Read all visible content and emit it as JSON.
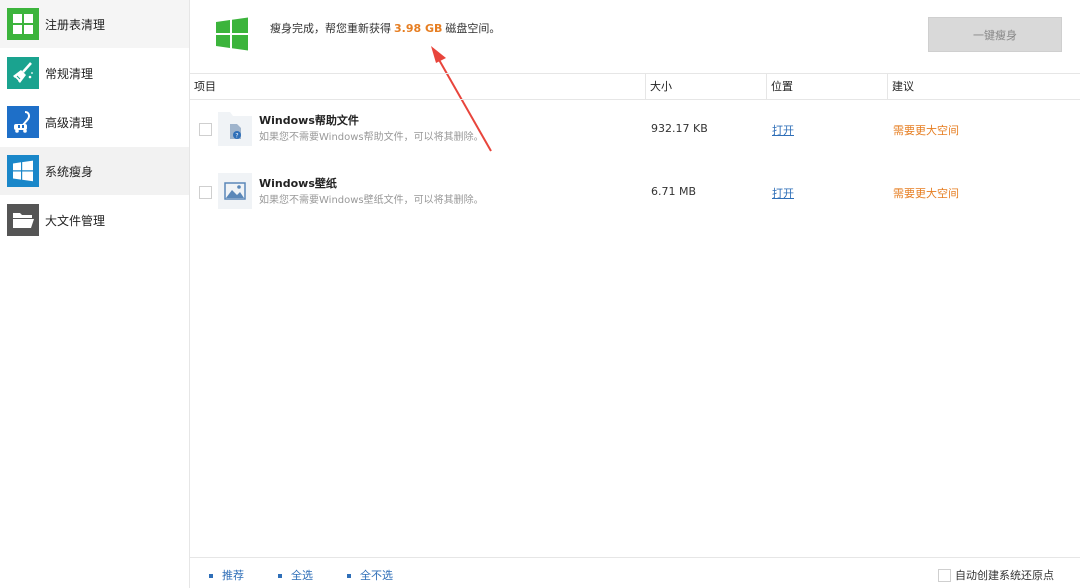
{
  "sidebar": {
    "items": [
      {
        "label": "注册表清理",
        "icon": "registry-grid-icon",
        "color": "#3cb43c"
      },
      {
        "label": "常规清理",
        "icon": "broom-icon",
        "color": "#1aa38f"
      },
      {
        "label": "高级清理",
        "icon": "vacuum-icon",
        "color": "#1e6fc8"
      },
      {
        "label": "系统瘦身",
        "icon": "windows-logo-icon",
        "color": "#1a87c9"
      },
      {
        "label": "大文件管理",
        "icon": "folder-icon",
        "color": "#555555"
      }
    ]
  },
  "summary": {
    "prefix": "瘦身完成，帮您重新获得",
    "amount": "3.98 GB",
    "suffix": "磁盘空间。",
    "icon": "windows-logo-icon",
    "icon_color": "#3cb43c",
    "button_label": "一键瘦身"
  },
  "table": {
    "headers": {
      "item": "项目",
      "size": "大小",
      "location": "位置",
      "suggestion": "建议"
    },
    "rows": [
      {
        "title": "Windows帮助文件",
        "desc": "如果您不需要Windows帮助文件，可以将其删除。",
        "size": "932.17 KB",
        "location": "打开",
        "suggestion": "需要更大空间",
        "icon": "help-file-icon"
      },
      {
        "title": "Windows壁纸",
        "desc": "如果您不需要Windows壁纸文件，可以将其删除。",
        "size": "6.71 MB",
        "location": "打开",
        "suggestion": "需要更大空间",
        "icon": "wallpaper-icon"
      }
    ]
  },
  "footer": {
    "recommend": "推荐",
    "select_all": "全选",
    "select_none": "全不选",
    "restore_point": "自动创建系统还原点"
  },
  "colors": {
    "accent_orange": "#e67e22",
    "link_blue": "#2f6fb8",
    "arrow_red": "#e8453c"
  }
}
